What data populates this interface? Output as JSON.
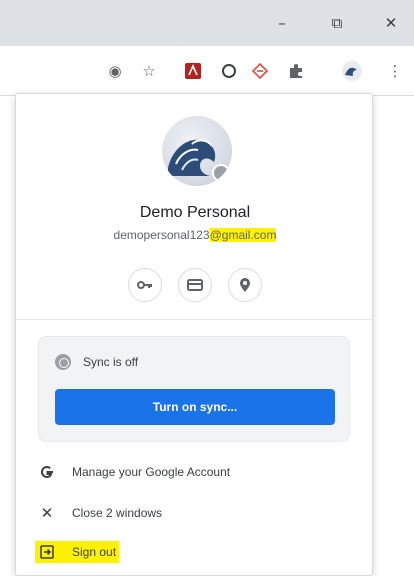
{
  "window": {
    "minimize_glyph": "–",
    "maximize_glyph": "⧉",
    "close_glyph": "✕"
  },
  "toolbar": {
    "icons": [
      "cast-icon",
      "bookmark-star-icon",
      "adobe-pdf-icon",
      "circle-icon",
      "arrow-diamond-icon",
      "extensions-puzzle-icon",
      "profile-avatar-icon",
      "more-menu-icon"
    ]
  },
  "profile": {
    "name": "Demo Personal",
    "email_user": "demopersonal123",
    "email_domain": "@gmail.com"
  },
  "quick_actions": [
    "passwords-key-icon",
    "payment-card-icon",
    "addresses-pin-icon"
  ],
  "sync": {
    "status": "Sync is off",
    "button_label": "Turn on sync..."
  },
  "menu": {
    "manage_account": "Manage your Google Account",
    "close_windows": "Close 2 windows",
    "sign_out": "Sign out"
  },
  "colors": {
    "accent": "#1a73e8",
    "highlight": "#fff200",
    "titlebar": "#dee1e6"
  }
}
